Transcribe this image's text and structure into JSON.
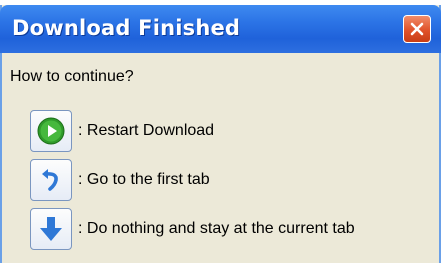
{
  "dialog": {
    "title": "Download Finished",
    "question": "How to continue?",
    "options": [
      {
        "icon": "play-icon",
        "label": ": Restart Download"
      },
      {
        "icon": "undo-arrow-icon",
        "label": ": Go to the first tab"
      },
      {
        "icon": "arrow-down-icon",
        "label": ": Do nothing and stay at the current tab"
      }
    ]
  },
  "colors": {
    "titlebar": "#2c74e6",
    "body": "#ece9d8",
    "close_button": "#e0522a",
    "play_green": "#2f9a2a",
    "arrow_blue": "#2f78d6"
  }
}
